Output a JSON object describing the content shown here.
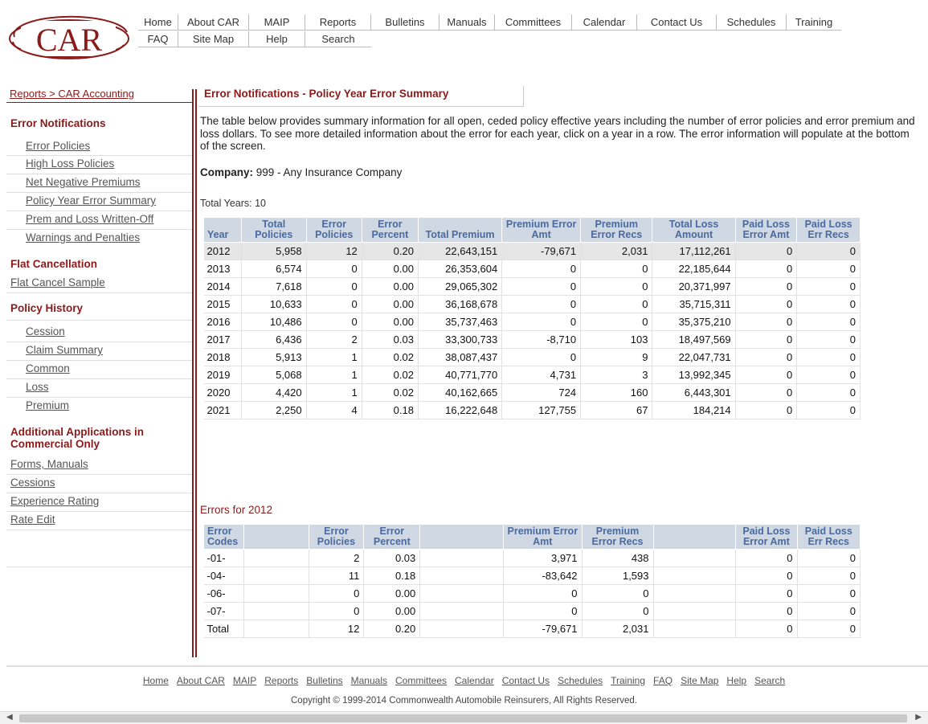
{
  "logo": {
    "text": "CAR",
    "color": "#8b1a1a"
  },
  "topnav": {
    "row1": [
      "Home",
      "About CAR",
      "MAIP",
      "Reports",
      "Bulletins",
      "Manuals",
      "Committees",
      "Calendar",
      "Contact Us",
      "Schedules",
      "Training"
    ],
    "row2": [
      "FAQ",
      "Site Map",
      "Help",
      "Search"
    ]
  },
  "breadcrumb": "Reports > CAR Accounting",
  "sidebar": {
    "error_notifications": "Error Notifications",
    "error_items": [
      "Error Policies",
      "High Loss Policies",
      "Net Negative Premiums",
      "Policy Year Error Summary",
      "Prem and Loss Written-Off",
      "Warnings and Penalties"
    ],
    "flat_cancellation": "Flat Cancellation",
    "flat_items": [
      "Flat Cancel Sample"
    ],
    "policy_history": "Policy History",
    "policy_items": [
      "Cession",
      "Claim Summary",
      "Common",
      "Loss",
      "Premium"
    ],
    "additional": "Additional Applications in Commercial Only",
    "additional_items": [
      "Forms, Manuals",
      "Cessions",
      "Experience Rating",
      "Rate Edit"
    ]
  },
  "main": {
    "title": "Error Notifications - Policy Year Error Summary",
    "intro": "The table below provides summary information for all open, ceded policy effective years including the number of error policies and error premium and loss dollars.  To see more detailed information about the error for each year, click on a year in a row.  The error information will populate at the bottom of the screen.",
    "company_label": "Company:",
    "company_value": " 999 - Any Insurance Company",
    "total_years": "Total Years: 10",
    "summary_headers": [
      "Year",
      "Total Policies",
      "Error Policies",
      "Error Percent",
      "Total Premium",
      "Premium Error Amt",
      "Premium Error Recs",
      "Total Loss Amount",
      "Paid Loss Error Amt",
      "Paid Loss Err Recs"
    ],
    "summary_rows": [
      [
        "2012",
        "5,958",
        "12",
        "0.20",
        "22,643,151",
        "-79,671",
        "2,031",
        "17,112,261",
        "0",
        "0"
      ],
      [
        "2013",
        "6,574",
        "0",
        "0.00",
        "26,353,604",
        "0",
        "0",
        "22,185,644",
        "0",
        "0"
      ],
      [
        "2014",
        "7,618",
        "0",
        "0.00",
        "29,065,302",
        "0",
        "0",
        "20,371,997",
        "0",
        "0"
      ],
      [
        "2015",
        "10,633",
        "0",
        "0.00",
        "36,168,678",
        "0",
        "0",
        "35,715,311",
        "0",
        "0"
      ],
      [
        "2016",
        "10,486",
        "0",
        "0.00",
        "35,737,463",
        "0",
        "0",
        "35,375,210",
        "0",
        "0"
      ],
      [
        "2017",
        "6,436",
        "2",
        "0.03",
        "33,300,733",
        "-8,710",
        "103",
        "18,497,569",
        "0",
        "0"
      ],
      [
        "2018",
        "5,913",
        "1",
        "0.02",
        "38,087,437",
        "0",
        "9",
        "22,047,731",
        "0",
        "0"
      ],
      [
        "2019",
        "5,068",
        "1",
        "0.02",
        "40,771,770",
        "4,731",
        "3",
        "13,992,345",
        "0",
        "0"
      ],
      [
        "2020",
        "4,420",
        "1",
        "0.02",
        "40,162,665",
        "724",
        "160",
        "6,443,301",
        "0",
        "0"
      ],
      [
        "2021",
        "2,250",
        "4",
        "0.18",
        "16,222,648",
        "127,755",
        "67",
        "184,214",
        "0",
        "0"
      ]
    ],
    "errors_label": "Errors for 2012",
    "error_headers": [
      "Error Codes",
      "",
      "Error Policies",
      "Error Percent",
      "",
      "Premium Error Amt",
      "Premium Error Recs",
      "",
      "Paid Loss Error Amt",
      "Paid Loss Err Recs"
    ],
    "error_rows": [
      [
        "-01-",
        "",
        "2",
        "0.03",
        "",
        "3,971",
        "438",
        "",
        "0",
        "0"
      ],
      [
        "-04-",
        "",
        "11",
        "0.18",
        "",
        "-83,642",
        "1,593",
        "",
        "0",
        "0"
      ],
      [
        "-06-",
        "",
        "0",
        "0.00",
        "",
        "0",
        "0",
        "",
        "0",
        "0"
      ],
      [
        "-07-",
        "",
        "0",
        "0.00",
        "",
        "0",
        "0",
        "",
        "0",
        "0"
      ],
      [
        "Total",
        "",
        "12",
        "0.20",
        "",
        "-79,671",
        "2,031",
        "",
        "0",
        "0"
      ]
    ]
  },
  "footer": {
    "links": [
      "Home",
      "About CAR",
      "MAIP",
      "Reports",
      "Bulletins",
      "Manuals",
      "Committees",
      "Calendar",
      "Contact Us",
      "Schedules",
      "Training",
      "FAQ",
      "Site Map",
      "Help",
      "Search"
    ],
    "copyright": "Copyright © 1999-2014 Commonwealth Automobile Reinsurers, All Rights Reserved."
  },
  "colors": {
    "accent": "#8b1a1a",
    "header_bg": "#cfd8e3",
    "header_text": "#4a6aa0"
  }
}
